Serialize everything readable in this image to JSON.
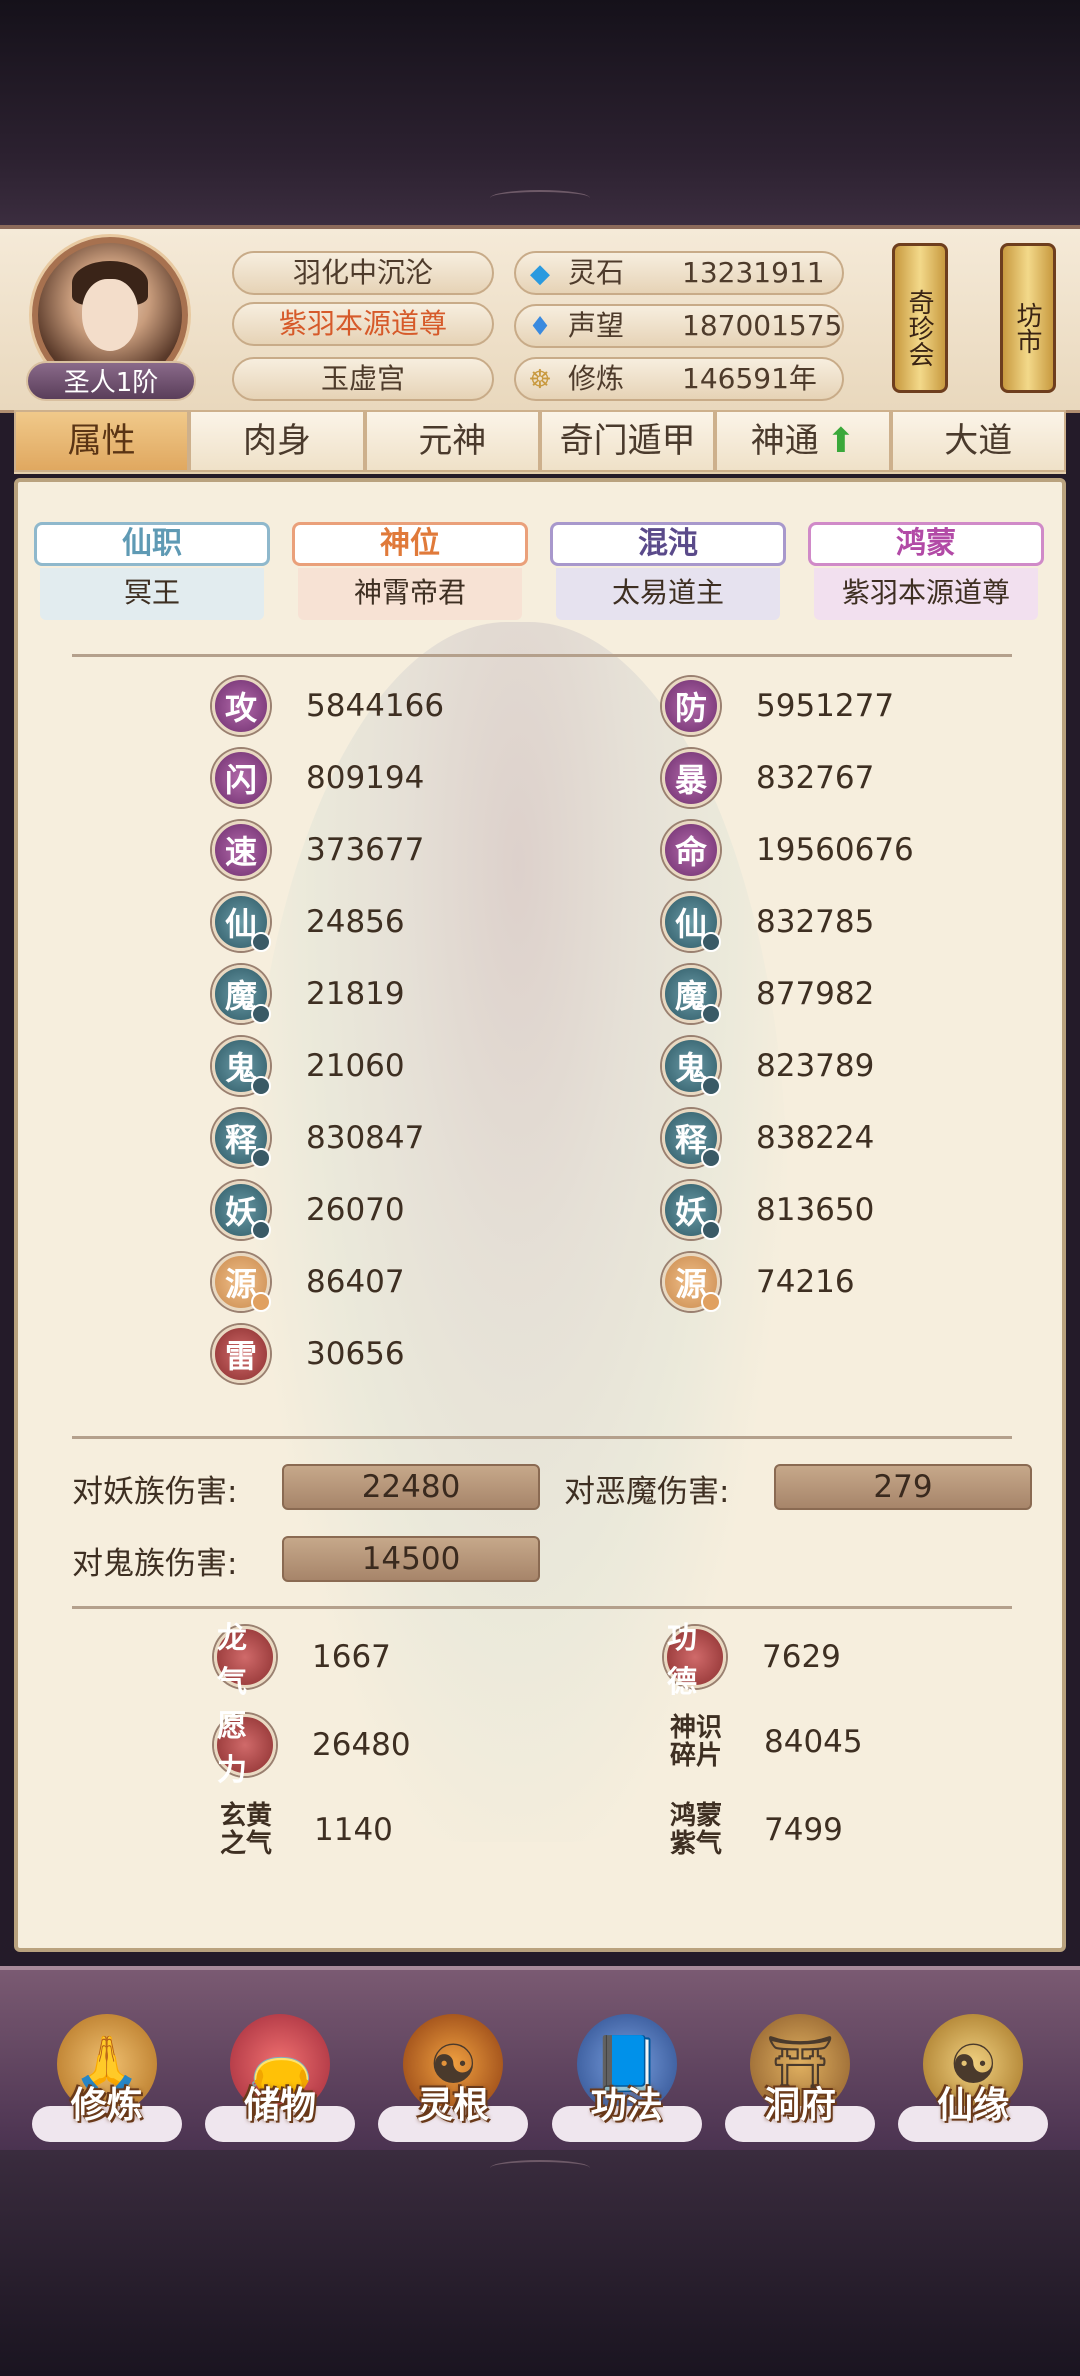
{
  "player": {
    "rank": "圣人1阶",
    "title_1": "羽化中沉沦",
    "title_2": "紫羽本源道尊",
    "sect": "玉虚宫"
  },
  "resources": [
    {
      "icon": "crystal-icon",
      "label": "灵石",
      "value": "13231911"
    },
    {
      "icon": "flame-icon",
      "label": "声望",
      "value": "187001575"
    },
    {
      "icon": "meditation-icon",
      "label": "修炼",
      "value": "146591年"
    }
  ],
  "side_buttons": {
    "treasure": "奇珍会",
    "market": "坊市"
  },
  "tabs": [
    {
      "label": "属性",
      "active": true
    },
    {
      "label": "肉身"
    },
    {
      "label": "元神"
    },
    {
      "label": "奇门遁甲"
    },
    {
      "label": "神通"
    },
    {
      "label": "大道"
    }
  ],
  "title_cards": [
    {
      "header": "仙职",
      "value": "冥王",
      "color": "#5f9ab4"
    },
    {
      "header": "神位",
      "value": "神霄帝君",
      "color": "#e07a3a"
    },
    {
      "header": "混沌",
      "value": "太易道主",
      "color": "#7a64a8"
    },
    {
      "header": "鸿蒙",
      "value": "紫羽本源道尊",
      "color": "#b24aa6"
    }
  ],
  "stats_left": [
    {
      "char": "攻",
      "value": "5844166"
    },
    {
      "char": "闪",
      "value": "809194"
    },
    {
      "char": "速",
      "value": "373677"
    },
    {
      "char": "仙",
      "value": "24856"
    },
    {
      "char": "魔",
      "value": "21819"
    },
    {
      "char": "鬼",
      "value": "21060"
    },
    {
      "char": "释",
      "value": "830847"
    },
    {
      "char": "妖",
      "value": "26070"
    },
    {
      "char": "源",
      "value": "86407"
    },
    {
      "char": "雷",
      "value": "30656"
    }
  ],
  "stats_right": [
    {
      "char": "防",
      "value": "5951277"
    },
    {
      "char": "暴",
      "value": "832767"
    },
    {
      "char": "命",
      "value": "19560676"
    },
    {
      "char": "仙",
      "value": "832785"
    },
    {
      "char": "魔",
      "value": "877982"
    },
    {
      "char": "鬼",
      "value": "823789"
    },
    {
      "char": "释",
      "value": "838224"
    },
    {
      "char": "妖",
      "value": "813650"
    },
    {
      "char": "源",
      "value": "74216"
    }
  ],
  "damage": {
    "yao_label": "对妖族伤害:",
    "yao_value": "22480",
    "demon_label": "对恶魔伤害:",
    "demon_value": "279",
    "ghost_label": "对鬼族伤害:",
    "ghost_value": "14500"
  },
  "misc": {
    "longqi_label": "龙气",
    "longqi_value": "1667",
    "gongde_label": "功德",
    "gongde_value": "7629",
    "yuanli_label": "愿力",
    "yuanli_value": "26480",
    "shenshi_label": "神识碎片",
    "shenshi_value": "84045",
    "xuanhuang_label": "玄黄之气",
    "xuanhuang_value": "1140",
    "hongmeng_label": "鸿蒙紫气",
    "hongmeng_value": "7499"
  },
  "bottom_nav": [
    {
      "label": "修炼",
      "icon": "cultivate-icon"
    },
    {
      "label": "储物",
      "icon": "bag-icon"
    },
    {
      "label": "灵根",
      "icon": "spirit-root-icon"
    },
    {
      "label": "功法",
      "icon": "book-icon"
    },
    {
      "label": "洞府",
      "icon": "cave-house-icon"
    },
    {
      "label": "仙缘",
      "icon": "gourd-icon"
    }
  ]
}
